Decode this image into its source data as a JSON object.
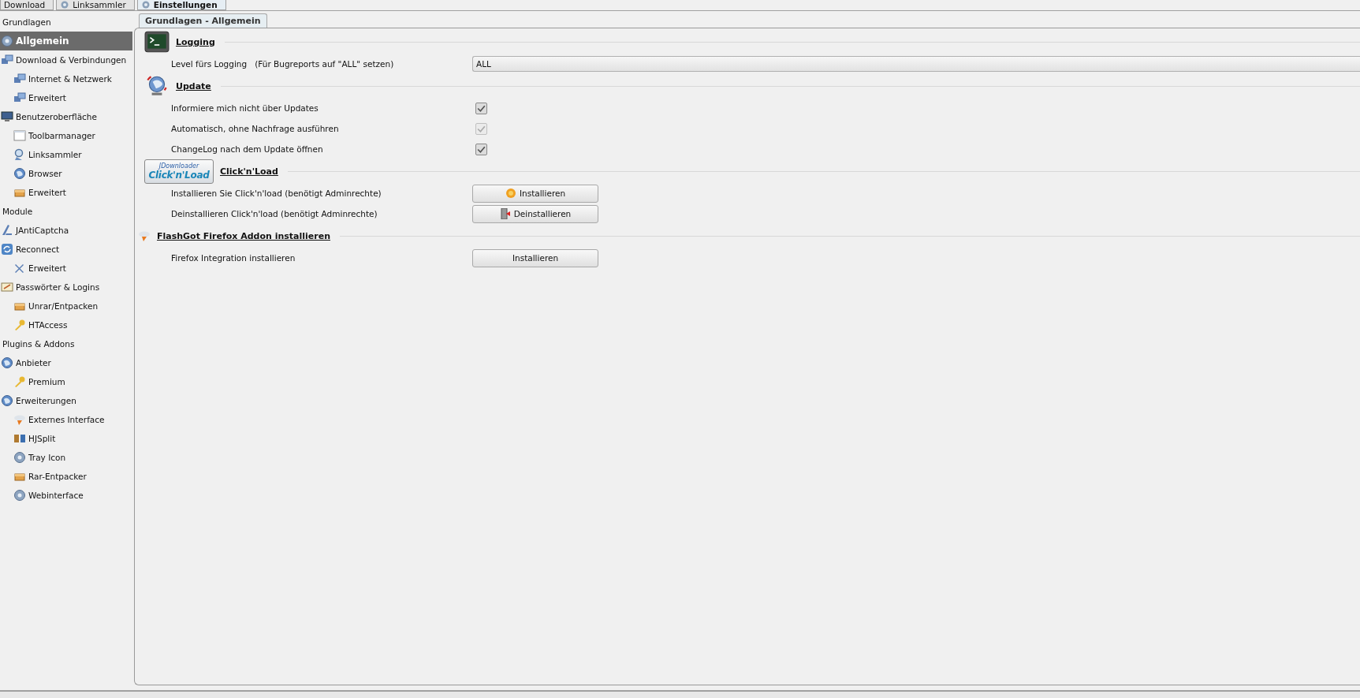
{
  "top_tabs": [
    {
      "label": "Download",
      "selected": false
    },
    {
      "label": "Linksammler",
      "selected": false
    },
    {
      "label": "Einstellungen",
      "selected": true
    }
  ],
  "sidebar": {
    "sections": [
      {
        "label": "Grundlagen",
        "items": [
          {
            "label": "Allgemein",
            "selected": true
          },
          {
            "label": "Download & Verbindungen",
            "selected": false,
            "children": [
              {
                "label": "Internet & Netzwerk",
                "selected": false
              },
              {
                "label": "Erweitert",
                "selected": false
              }
            ]
          },
          {
            "label": "Benutzeroberfläche",
            "selected": false,
            "children": [
              {
                "label": "Toolbarmanager",
                "selected": false
              },
              {
                "label": "Linksammler",
                "selected": false
              },
              {
                "label": "Browser",
                "selected": false
              },
              {
                "label": "Erweitert",
                "selected": false
              }
            ]
          }
        ]
      },
      {
        "label": "Module",
        "items": [
          {
            "label": "JAntiCaptcha",
            "selected": false
          },
          {
            "label": "Reconnect",
            "selected": false,
            "children": [
              {
                "label": "Erweitert",
                "selected": false
              }
            ]
          },
          {
            "label": "Passwörter & Logins",
            "selected": false,
            "children": [
              {
                "label": "Unrar/Entpacken",
                "selected": false
              },
              {
                "label": "HTAccess",
                "selected": false
              }
            ]
          }
        ]
      },
      {
        "label": "Plugins & Addons",
        "items": [
          {
            "label": "Anbieter",
            "selected": false,
            "children": [
              {
                "label": "Premium",
                "selected": false
              }
            ]
          },
          {
            "label": "Erweiterungen",
            "selected": false,
            "children": [
              {
                "label": "Externes Interface",
                "selected": false
              },
              {
                "label": "HJSplit",
                "selected": false
              },
              {
                "label": "Tray Icon",
                "selected": false
              },
              {
                "label": "Rar-Entpacker",
                "selected": false
              },
              {
                "label": "Webinterface",
                "selected": false
              }
            ]
          }
        ]
      }
    ]
  },
  "content": {
    "tab": {
      "label": "Grundlagen - Allgemein",
      "selected": true
    },
    "sections": [
      {
        "title": "Logging",
        "rows": [
          {
            "kind": "dropdown",
            "label": "Level fürs Logging   (Für Bugreports auf \"ALL\" setzen)",
            "value": "ALL"
          }
        ]
      },
      {
        "title": "Update",
        "rows": [
          {
            "kind": "checkbox",
            "label": "Informiere mich nicht über Updates",
            "checked": true,
            "disabled": false
          },
          {
            "kind": "checkbox",
            "label": "Automatisch, ohne Nachfrage ausführen",
            "checked": true,
            "disabled": true
          },
          {
            "kind": "checkbox",
            "label": "ChangeLog nach dem Update öffnen",
            "checked": true,
            "disabled": false
          }
        ]
      },
      {
        "title": "Click'n'Load",
        "logo_text": [
          "JDownloader",
          "Click'n'Load"
        ],
        "rows": [
          {
            "kind": "button",
            "label": "Installieren Sie Click'n'load (benötigt Adminrechte)",
            "button": "Installieren"
          },
          {
            "kind": "button",
            "label": "Deinstallieren Click'n'load (benötigt Adminrechte)",
            "button": "Deinstallieren"
          }
        ]
      },
      {
        "title": "FlashGot Firefox Addon installieren",
        "rows": [
          {
            "kind": "button",
            "label": "Firefox Integration installieren",
            "button": "Installieren"
          }
        ]
      }
    ]
  }
}
